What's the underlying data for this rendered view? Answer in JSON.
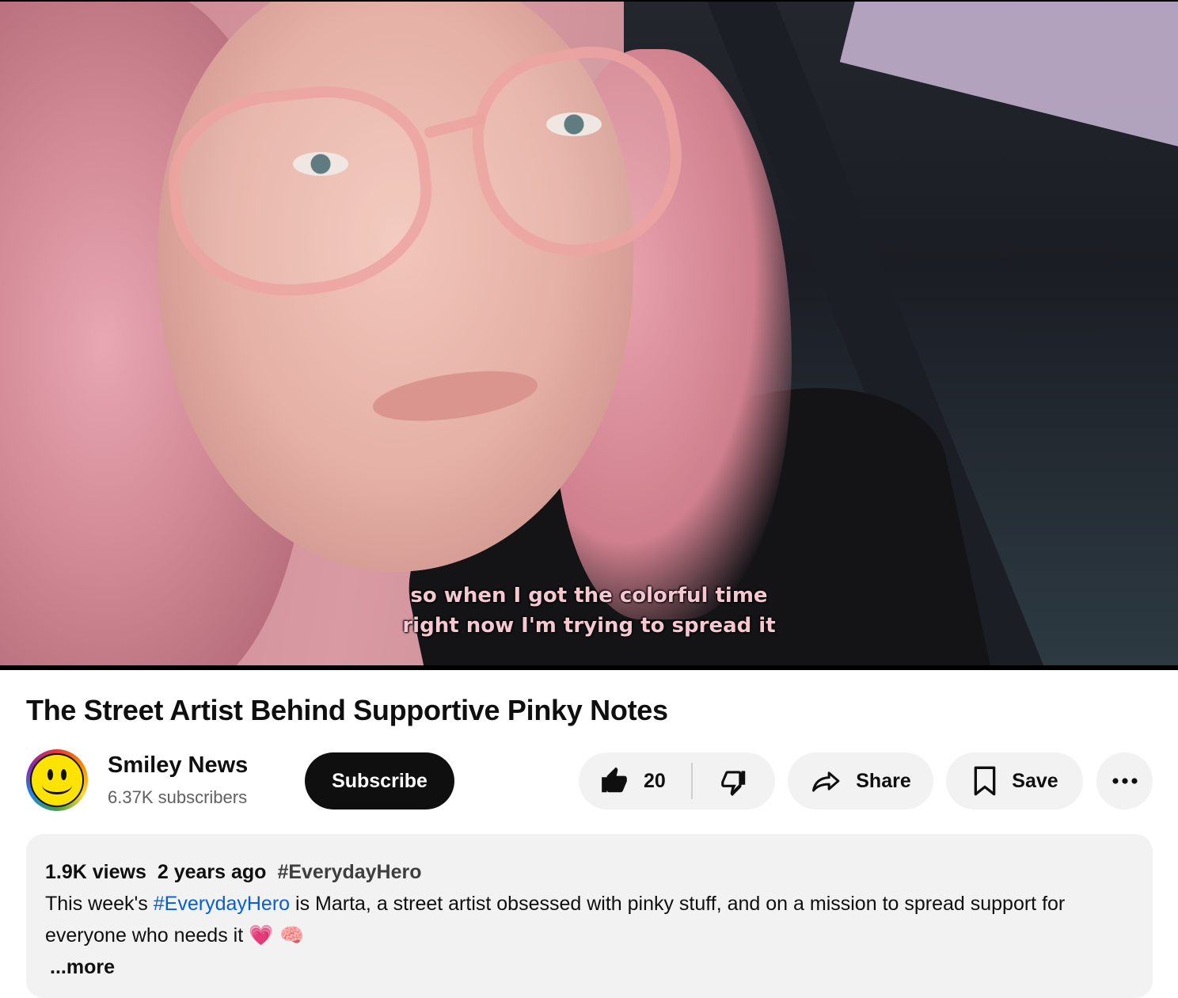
{
  "video": {
    "captions": [
      "so when I got the colorful time",
      "right now I'm trying to spread it"
    ]
  },
  "title": "The Street Artist Behind Supportive Pinky Notes",
  "channel": {
    "name": "Smiley News",
    "subscribers": "6.37K subscribers",
    "subscribe_label": "Subscribe",
    "avatar_icon": "smiley-face-icon"
  },
  "actions": {
    "like_count": "20",
    "share_label": "Share",
    "save_label": "Save",
    "icons": [
      "thumbs-up-icon",
      "thumbs-down-icon",
      "share-arrow-icon",
      "bookmark-icon",
      "more-icon"
    ]
  },
  "description": {
    "views": "1.9K views",
    "age": "2 years ago",
    "hashtag": "#EverydayHero",
    "text_before": "This week's ",
    "text_link": "#EverydayHero",
    "text_after": " is Marta, a street artist obsessed with pinky stuff, and on a mission to spread support for everyone who needs it",
    "emojis": "💗 🧠",
    "more_label": "...more"
  },
  "colors": {
    "link": "#065fd4",
    "subscribe_bg": "#0f0f0f",
    "pill_bg": "#f2f2f2",
    "caption": "#f4c7d1"
  }
}
